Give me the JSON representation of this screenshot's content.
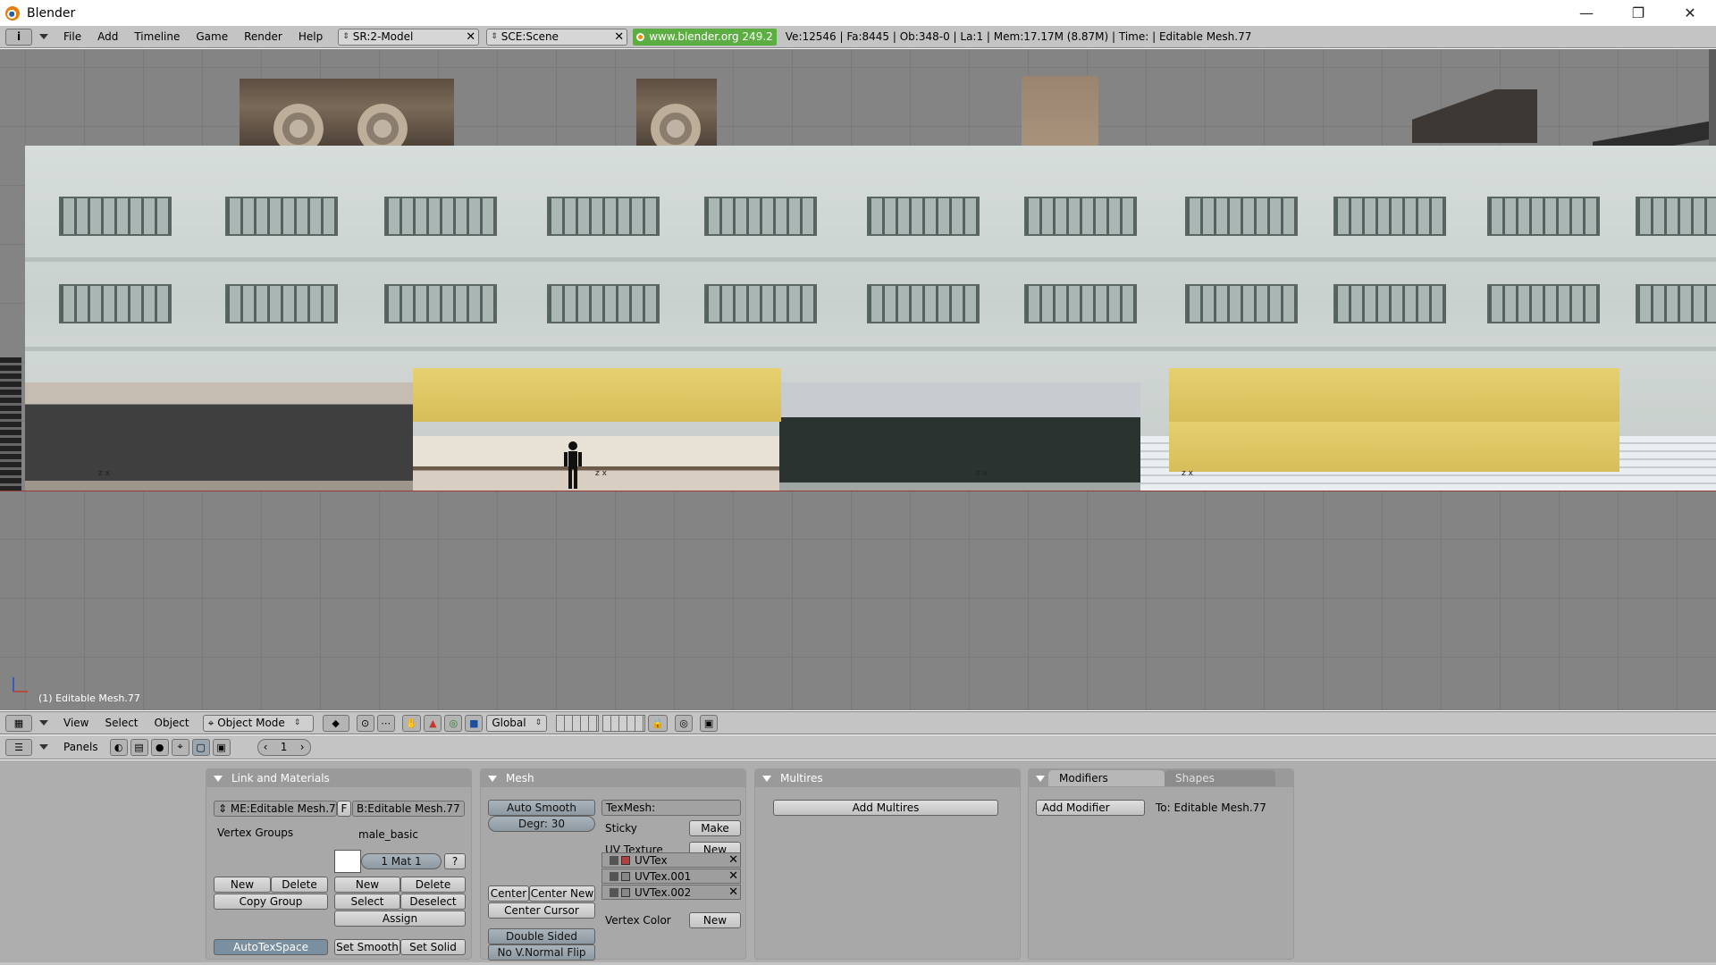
{
  "window": {
    "title": "Blender",
    "minimize": "—",
    "maximize": "❐",
    "close": "✕"
  },
  "info_header": {
    "icon_label": "i",
    "menus": [
      "File",
      "Add",
      "Timeline",
      "Game",
      "Render",
      "Help"
    ],
    "screen_field": "SR:2-Model",
    "scene_field": "SCE:Scene",
    "url_badge": "www.blender.org 249.2",
    "stats": "Ve:12546 | Fa:8445 | Ob:348-0 | La:1  | Mem:17.17M (8.87M)  | Time: | Editable Mesh.77"
  },
  "viewport": {
    "object_label": "(1) Editable Mesh.77",
    "axis_z": "z",
    "axis_x": "x"
  },
  "view3d_header": {
    "menus": [
      "View",
      "Select",
      "Object"
    ],
    "mode": "Object Mode",
    "orientation": "Global"
  },
  "buttons_header": {
    "panels_label": "Panels",
    "frame": "1"
  },
  "panels": {
    "link_materials": {
      "title": "Link and Materials",
      "mesh_name": "ME:Editable Mesh.77",
      "f_label": "F",
      "ob_name": "B:Editable Mesh.77",
      "vertex_groups": "Vertex Groups",
      "group_name": "male_basic",
      "mat_label": "1 Mat 1",
      "question": "?",
      "new_group": "New",
      "delete_group": "Delete",
      "copy_group": "Copy Group",
      "new_mat": "New",
      "delete_mat": "Delete",
      "select": "Select",
      "deselect": "Deselect",
      "assign": "Assign",
      "autotexspace": "AutoTexSpace",
      "set_smooth": "Set Smooth",
      "set_solid": "Set Solid"
    },
    "mesh": {
      "title": "Mesh",
      "auto_smooth": "Auto Smooth",
      "degr": "Degr: 30",
      "center": "Center",
      "center_new": "Center New",
      "center_cursor": "Center Cursor",
      "double_sided": "Double Sided",
      "no_vnormal_flip": "No V.Normal Flip",
      "texmesh": "TexMesh:",
      "sticky": "Sticky",
      "make": "Make",
      "uv_texture": "UV Texture",
      "uv_new": "New",
      "uv_layers": [
        "UVTex",
        "UVTex.001",
        "UVTex.002"
      ],
      "vertex_color": "Vertex Color",
      "vc_new": "New"
    },
    "multires": {
      "title": "Multires",
      "add_multires": "Add Multires"
    },
    "modifiers": {
      "tab_modifiers": "Modifiers",
      "tab_shapes": "Shapes",
      "add_modifier": "Add Modifier",
      "to_label": "To: Editable Mesh.77"
    }
  }
}
